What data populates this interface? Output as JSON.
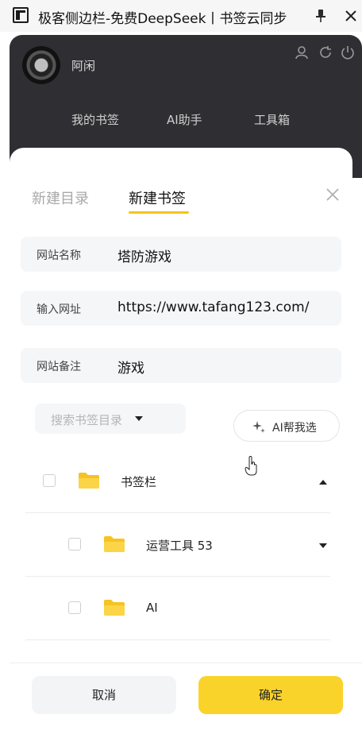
{
  "window": {
    "title": "极客侧边栏-免费DeepSeek丨书签云同步"
  },
  "header": {
    "username": "阿闲",
    "tabs": [
      "我的书签",
      "AI助手",
      "工具箱"
    ]
  },
  "panel": {
    "tabs": [
      "新建目录",
      "新建书签"
    ],
    "active_tab": "新建书签"
  },
  "form": {
    "name_label": "网站名称",
    "name_value": "塔防游戏",
    "url_label": "输入网址",
    "url_value": "https://www.tafang123.com/",
    "note_label": "网站备注",
    "note_value": "游戏"
  },
  "directory": {
    "placeholder": "搜索书签目录",
    "ai_label": "AI帮我选"
  },
  "tree": [
    {
      "label": "书签栏",
      "expanded": true
    },
    {
      "label": "运营工具 53",
      "expanded": false
    },
    {
      "label": "AI"
    }
  ],
  "footer": {
    "cancel_label": "取消",
    "confirm_label": "确定"
  },
  "colors": {
    "accent": "#f9d32a",
    "folder": "#f7c321",
    "header_bg": "#2f2f33"
  }
}
